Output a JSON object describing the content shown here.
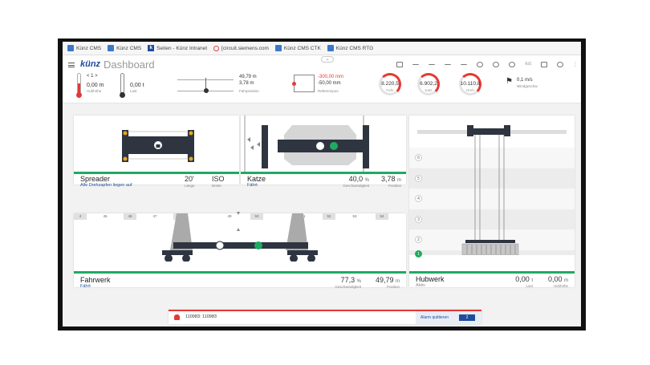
{
  "bookmarks": [
    {
      "label": "Künz CMS",
      "icon": "crane-icon"
    },
    {
      "label": "Künz CMS",
      "icon": "crane-icon"
    },
    {
      "label": "Seiten - Künz Intranet",
      "icon": "k-icon"
    },
    {
      "label": "[circuit.siemens.com",
      "icon": "google-icon"
    },
    {
      "label": "Künz CMS CTK",
      "icon": "crane-icon"
    },
    {
      "label": "Künz CMS RTG",
      "icon": "crane-icon"
    }
  ],
  "header": {
    "logo": "künz",
    "title": "Dashboard",
    "user_text": "kst"
  },
  "gauges": {
    "hoist": {
      "value": "0,00 m",
      "label": "Hubhöhe",
      "step": "< 1 >"
    },
    "load": {
      "value": "0,00 t",
      "label": "Last"
    },
    "trolley": {
      "value1": "49,79 m",
      "value2": "3,78 m",
      "label": "Fahrposition"
    },
    "offset": {
      "value1": "-300,00 mm",
      "value2": "-50,00 mm",
      "label": "Referenzpos."
    },
    "dials": [
      {
        "value": "8.220,5",
        "label": "Fahr"
      },
      {
        "value": "6.902,2",
        "label": "Katz"
      },
      {
        "value": "10.110,8",
        "label": "Dreh"
      }
    ],
    "wind": {
      "value": "0,1 m/s",
      "label": "Windgeschw."
    }
  },
  "cards": {
    "spreader": {
      "title": "Spreader",
      "subtitle": "Alle Drehzapfen liegen auf",
      "length_value": "20'",
      "length_label": "Länge",
      "iso_value": "ISO",
      "iso_label": "Breite"
    },
    "katze": {
      "title": "Katze",
      "subtitle": "Fährt",
      "speed_value": "40,0",
      "speed_unit": "%",
      "speed_label": "Geschwindigkeit",
      "pos_value": "3,78",
      "pos_unit": "m",
      "pos_label": "Position"
    },
    "fahrwerk": {
      "title": "Fahrwerk",
      "subtitle": "Fährt",
      "speed_value": "77,3",
      "speed_unit": "%",
      "speed_label": "Geschwindigkeit",
      "pos_value": "49,79",
      "pos_unit": "m",
      "pos_label": "Position",
      "ruler": [
        "4",
        "45",
        "46",
        "47",
        "48",
        "49",
        "50",
        "51",
        "52",
        "53",
        "54"
      ]
    },
    "hubwerk": {
      "title": "Hubwerk",
      "subtitle": "Aktiv",
      "load_value": "0,00",
      "load_unit": "t",
      "load_label": "Last",
      "height_value": "0,00",
      "height_unit": "m",
      "height_label": "Hubhöhe",
      "levels": [
        "6",
        "5",
        "4",
        "3",
        "2",
        "1"
      ],
      "active_level": "1"
    }
  },
  "alarm": {
    "text": "110983: 110983",
    "button_label": "Alarm quittieren",
    "count": "2"
  },
  "colors": {
    "accent_green": "#1faa62",
    "accent_blue": "#1d4d9c",
    "alarm_red": "#e53935",
    "dark_beam": "#2e3540"
  }
}
